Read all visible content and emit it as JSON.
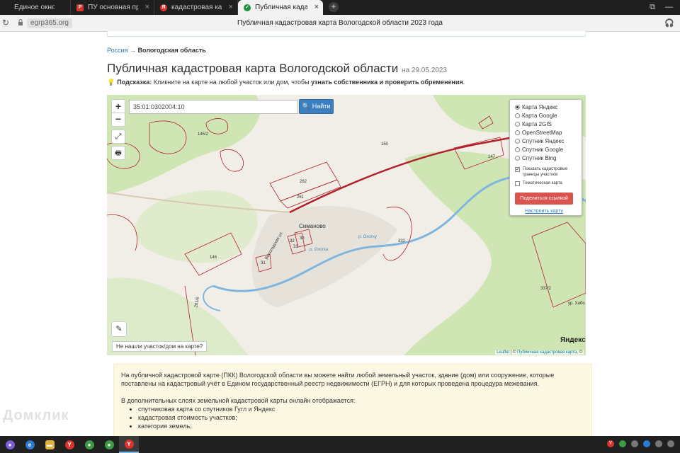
{
  "browser": {
    "tabs": [
      {
        "label": "Единое окно",
        "icon": "blank-icon"
      },
      {
        "label": "ПУ основная преза.pdf",
        "icon": "pdf-icon"
      },
      {
        "label": "кадастровая карта волог",
        "icon": "yandex-icon"
      },
      {
        "label": "Публичная кадастрова",
        "icon": "check-shield-icon",
        "active": true
      }
    ],
    "new_tab": "+",
    "url": "egrp365.org",
    "page_title": "Публичная кадастровая карта Вологодской области 2023 года"
  },
  "breadcrumb": {
    "root": "Россия",
    "separator": "→",
    "current": "Вологодская область"
  },
  "heading": {
    "title": "Публичная кадастровая карта Вологодской области",
    "date": "на 29.05.2023"
  },
  "hint": {
    "label": "Подсказка:",
    "text": "Кликните на карте на любой участок или дом, чтобы",
    "bold": "узнать собственника и проверить обременения",
    "end": "."
  },
  "map": {
    "search_value": "35:01:0302004:10",
    "find_button": "Найти",
    "zoom_in": "+",
    "zoom_out": "−",
    "not_found": "Не нашли участок/дом на карте?",
    "village": "Симаново",
    "yandex_logo": "Яндекс",
    "attribution_leaflet": "Leaflet",
    "attribution_sep": " | © ",
    "attribution_pkk": "Публичная кадастровая карта",
    "attribution_end": ", ©",
    "parcel_labels": [
      "145/2",
      "150",
      "147",
      "262",
      "261",
      "146",
      "332",
      "337/2",
      "261/6",
      "31",
      "31",
      "32",
      "33"
    ],
    "street_labels": [
      "Вологодская ул.",
      "р. Охотку",
      "р. Охотка",
      "ур. Хабо"
    ]
  },
  "layers": {
    "options": [
      {
        "label": "Карта Яндекс",
        "selected": true
      },
      {
        "label": "Карта Google",
        "selected": false
      },
      {
        "label": "Карта 2GIS",
        "selected": false
      },
      {
        "label": "OpenStreetMap",
        "selected": false
      },
      {
        "label": "Спутник Яндекс",
        "selected": false
      },
      {
        "label": "Спутник Google",
        "selected": false
      },
      {
        "label": "Спутник Bing",
        "selected": false
      }
    ],
    "show_cadastral": "Показать кадастровые границы участков",
    "thematic": "Тематическая карта",
    "share_button": "Поделиться ссылкой",
    "setup_link": "Настроить карту"
  },
  "info": {
    "paragraph1": "На публичной кадастровой карте (ПКК) Вологодской области вы можете найти любой земельный участок, здание (дом) или сооружение, которые поставлены на кадастровый учёт в Едином государственный реестр недвижимости (ЕГРН) и для которых проведена процедура межевания.",
    "paragraph2": "В дополнительных слоях земельной кадастровой карты онлайн отображается:",
    "items": [
      "спутниковая карта со спутников Гугл и Яндекс",
      "кадастровая стоимость участков;",
      "категория земель;"
    ]
  },
  "watermark": "Домклик",
  "colors": {
    "parcel_border": "#b2202a",
    "river": "#7fb6e0",
    "forest": "#cfe6b4",
    "share_button": "#d9534f",
    "find_button": "#3c7fc0",
    "info_bg": "#fcf8e3"
  }
}
